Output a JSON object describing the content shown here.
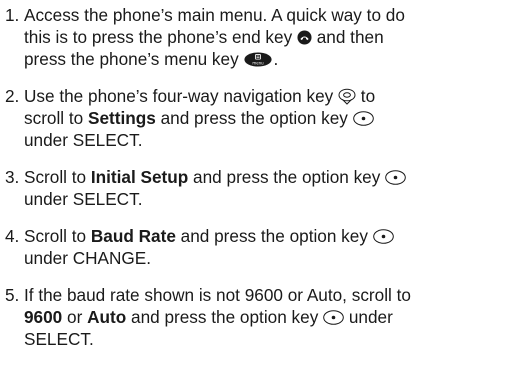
{
  "steps": [
    {
      "number": "1.",
      "line1": "Access the phone’s main menu. A quick way to do",
      "line2": "this is to press the phone’s end key",
      "line2_after": " and then",
      "line3": "press the phone’s menu key",
      "line3_after": ".",
      "icons": [
        "end-key-icon",
        "menu-key-icon"
      ],
      "menu_key_label": "menu"
    },
    {
      "number": "2.",
      "line1": "Use the phone’s four-way navigation key",
      "line1_after": " to",
      "line2_before": "scroll to ",
      "line2_bold": "Settings",
      "line2_after": " and press the option key",
      "line3": "under SELECT.",
      "icons": [
        "four-way-navigation-key-icon",
        "option-key-icon"
      ]
    },
    {
      "number": "3.",
      "line1_before": "Scroll to ",
      "line1_bold": "Initial Setup",
      "line1_after": " and press the option key",
      "line2": "under SELECT.",
      "icons": [
        "option-key-icon"
      ]
    },
    {
      "number": "4.",
      "line1_before": "Scroll to ",
      "line1_bold": "Baud Rate",
      "line1_after": " and press the option key",
      "line2": "under CHANGE.",
      "icons": [
        "option-key-icon"
      ]
    },
    {
      "number": "5.",
      "line1": "If the baud rate shown is not 9600 or Auto, scroll to",
      "line2_bold1": "9600",
      "line2_mid": " or ",
      "line2_bold2": "Auto",
      "line2_after1": " and press the option key",
      "line2_after2": " under",
      "line3": "SELECT.",
      "icons": [
        "option-key-icon"
      ]
    }
  ]
}
